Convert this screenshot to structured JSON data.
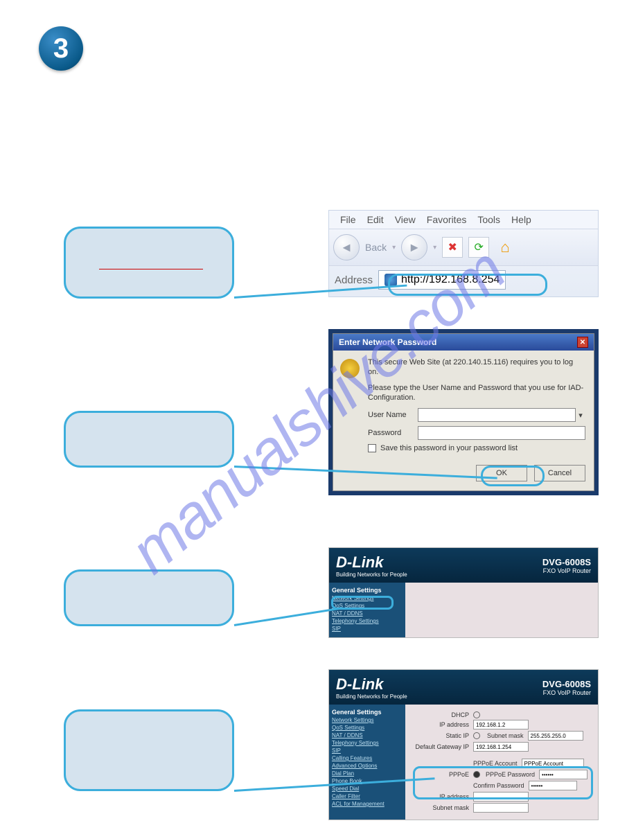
{
  "step_number": "3",
  "watermark": "manualshive.com",
  "panel1": {
    "menu": [
      "File",
      "Edit",
      "View",
      "Favorites",
      "Tools",
      "Help"
    ],
    "back_label": "Back",
    "address_label": "Address",
    "url": "http://192.168.8.254"
  },
  "panel2": {
    "title": "Enter Network Password",
    "line1": "This secure Web Site (at 220.140.15.116) requires you to log on.",
    "line2": "Please type the User Name and Password that you use for IAD-Configuration.",
    "user_label": "User Name",
    "pass_label": "Password",
    "save_label": "Save this password in your password list",
    "ok": "OK",
    "cancel": "Cancel"
  },
  "dlink": {
    "brand": "D-Link",
    "tagline": "Building Networks for People",
    "model": "DVG-6008S",
    "subtitle": "FXO VoIP Router"
  },
  "panel3_side": {
    "header": "General Settings",
    "items": [
      "Network Settings",
      "QoS Settings",
      "NAT / DDNS",
      "Telephony Settings",
      "SIP"
    ]
  },
  "panel4_side": {
    "header": "General Settings",
    "items": [
      "Network Settings",
      "QoS Settings",
      "NAT / DDNS",
      "Telephony Settings",
      "SIP",
      "Calling Features",
      "Advanced Options",
      "Dial Plan",
      "Phone Book",
      "Speed Dial",
      "Caller Filter",
      "ACL for Management"
    ]
  },
  "panel4_cfg": {
    "dhcp": "DHCP",
    "ip_label": "IP address",
    "ip_val": "192.168.1.2",
    "static": "Static IP",
    "subnet_label": "Subnet mask",
    "subnet_val": "255.255.255.0",
    "gw_label": "Default Gateway IP",
    "gw_val": "192.168.1.254",
    "pppoe": "PPPoE",
    "acct_label": "PPPoE Account",
    "acct_val": "PPPoE Account",
    "pass_label": "PPPoE Password",
    "confirm_label": "Confirm Password",
    "ip2_label": "IP address",
    "mask2_label": "Subnet mask"
  }
}
